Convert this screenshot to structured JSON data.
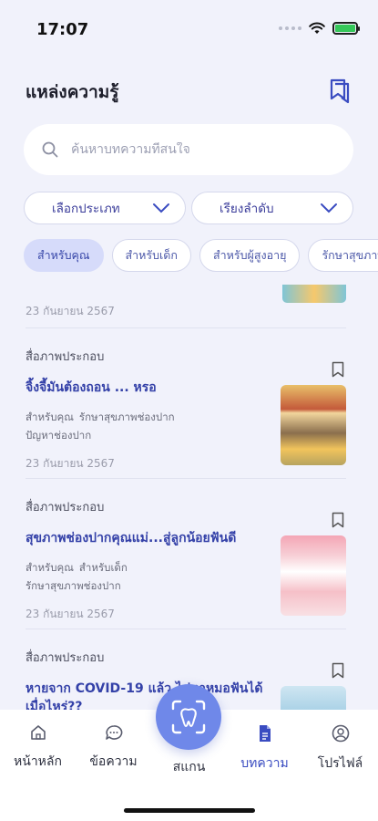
{
  "status": {
    "time": "17:07"
  },
  "header": {
    "title": "แหล่งความรู้"
  },
  "search": {
    "placeholder": "ค้นหาบทความที่สนใจ"
  },
  "filters": {
    "category": "เลือกประเภท",
    "sort": "เรียงลำดับ"
  },
  "chips": [
    "สำหรับคุณ",
    "สำหรับเด็ก",
    "สำหรับผู้สูงอายุ",
    "รักษาสุขภาพช่องปาก"
  ],
  "previous_article": {
    "date": "23 กันยายน 2567"
  },
  "articles": [
    {
      "type": "สื่อภาพประกอบ",
      "title": "จิ้งจี้มันต้องถอน ... หรอ",
      "tags": [
        "สำหรับคุณ",
        "รักษาสุขภาพช่องปาก",
        "ปัญหาช่องปาก"
      ],
      "date": "23 กันยายน 2567"
    },
    {
      "type": "สื่อภาพประกอบ",
      "title": "สุขภาพช่องปากคุณแม่...สู่ลูกน้อยฟันดี",
      "tags": [
        "สำหรับคุณ",
        "สำหรับเด็ก",
        "รักษาสุขภาพช่องปาก"
      ],
      "date": "23 กันยายน 2567"
    },
    {
      "type": "สื่อภาพประกอบ",
      "title": "หายจาก COVID-19 แล้ว ไปหาหมอฟันได้เมื่อไหร่??",
      "tags": [],
      "date": ""
    }
  ],
  "nav": {
    "home": "หน้าหลัก",
    "messages": "ข้อความ",
    "scan": "สแกน",
    "articles": "บทความ",
    "profile": "โปรไฟล์"
  },
  "colors": {
    "accent": "#3a4cc1",
    "scan_button": "#6f88e9",
    "background": "#f1f2fb"
  }
}
